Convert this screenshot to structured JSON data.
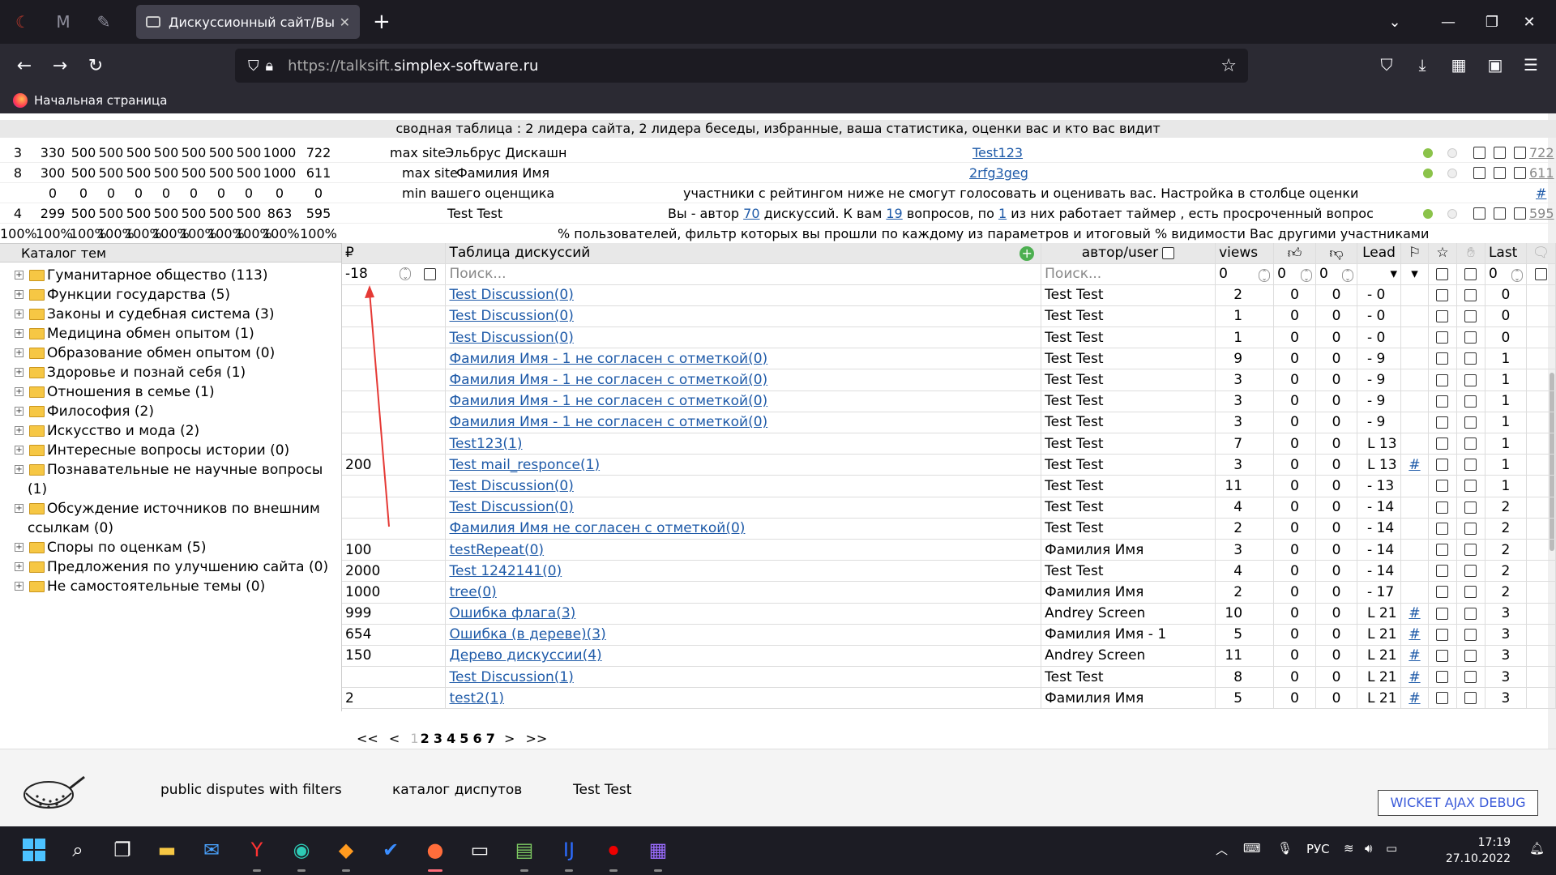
{
  "browser": {
    "tab_title": "Дискуссионный сайт/Выбор т",
    "url_prefix": "https://talksift.",
    "url_domain": "simplex-software.ru",
    "bookmark": "Начальная страница"
  },
  "summary": {
    "title": "сводная таблица : 2 лидера сайта, 2 лидера беседы, избранные, ваша статистика, оценки вас и кто вас видит",
    "rows": [
      {
        "nums": [
          "3",
          "330",
          "500",
          "500",
          "500",
          "500",
          "500",
          "500",
          "500",
          "1000",
          "722"
        ],
        "label": "max site",
        "name": "Эльбрус Дискашн",
        "link": "Test123",
        "end": "722"
      },
      {
        "nums": [
          "8",
          "300",
          "500",
          "500",
          "500",
          "500",
          "500",
          "500",
          "500",
          "1000",
          "611"
        ],
        "label": "max site",
        "name": "Фамилия Имя",
        "link": "2rfg3geg",
        "end": "611"
      },
      {
        "nums": [
          "",
          "0",
          "0",
          "0",
          "0",
          "0",
          "0",
          "0",
          "0",
          "0",
          "0"
        ],
        "label": "min вашего оценщика",
        "text": "участники с рейтингом ниже не смогут голосовать и оценивать вас. Настройка в столбце оценки",
        "end": "#"
      },
      {
        "nums": [
          "4",
          "299",
          "500",
          "500",
          "500",
          "500",
          "500",
          "500",
          "500",
          "863",
          "595"
        ],
        "label": "",
        "name": "Test Test",
        "text_a": "Вы - автор ",
        "link_a": "70",
        "text_b": " дискуссий. К вам ",
        "link_b": "19",
        "text_c": " вопросов, по ",
        "link_c": "1",
        "text_d": " из них работает таймер , есть просроченный вопрос",
        "end": "595"
      }
    ],
    "pct_row": [
      "100%",
      "100%",
      "100%",
      "100%",
      "100%",
      "100%",
      "100%",
      "100%",
      "100%",
      "100%",
      "100%"
    ],
    "pct_text": "% пользователей, фильтр которых вы прошли по каждому из параметров и итоговый % видимости Вас другими участниками"
  },
  "catalog": {
    "title": "Каталог тем",
    "items": [
      "Гуманитарное общество (113)",
      "Функции государства (5)",
      "Законы и судебная система (3)",
      "Медицина обмен опытом (1)",
      "Образование обмен опытом (0)",
      "Здоровье и познай себя (1)",
      "Отношения в семье (1)",
      "Философия (2)",
      "Искусство и мода (2)",
      "Интересные вопросы истории (0)",
      "Познавательные не научные вопросы",
      "(1)",
      "Обсуждение источников по внешним",
      "ссылкам (0)",
      "Споры по оценкам (5)",
      "Предложения по улучшению сайта (0)",
      "Не самостоятельные темы (0)"
    ]
  },
  "table": {
    "h_price": "₽",
    "h_title": "Таблица дискуссий",
    "h_author": "автор/user",
    "h_views": "views",
    "h_lead": "Lead",
    "h_last": "Last",
    "filter_price": "-18",
    "search_placeholder": "Поиск...",
    "author_placeholder": "Поиск...",
    "f_views": "0",
    "f_up": "0",
    "f_down": "0",
    "f_last": "0",
    "rows": [
      {
        "price": "",
        "title": "Test Discussion(0)",
        "author": "Test Test",
        "views": "2",
        "up": "0",
        "down": "0",
        "lead": "- 0",
        "flag": "",
        "last": "0"
      },
      {
        "price": "",
        "title": "Test Discussion(0)",
        "author": "Test Test",
        "views": "1",
        "up": "0",
        "down": "0",
        "lead": "- 0",
        "flag": "",
        "last": "0"
      },
      {
        "price": "",
        "title": "Test Discussion(0)",
        "author": "Test Test",
        "views": "1",
        "up": "0",
        "down": "0",
        "lead": "- 0",
        "flag": "",
        "last": "0"
      },
      {
        "price": "",
        "title": "Фамилия Имя - 1 не согласен с отметкой(0)",
        "author": "Test Test",
        "views": "9",
        "up": "0",
        "down": "0",
        "lead": "- 9",
        "flag": "",
        "last": "1"
      },
      {
        "price": "",
        "title": "Фамилия Имя - 1 не согласен с отметкой(0)",
        "author": "Test Test",
        "views": "3",
        "up": "0",
        "down": "0",
        "lead": "- 9",
        "flag": "",
        "last": "1"
      },
      {
        "price": "",
        "title": "Фамилия Имя - 1 не согласен с отметкой(0)",
        "author": "Test Test",
        "views": "3",
        "up": "0",
        "down": "0",
        "lead": "- 9",
        "flag": "",
        "last": "1"
      },
      {
        "price": "",
        "title": "Фамилия Имя - 1 не согласен с отметкой(0)",
        "author": "Test Test",
        "views": "3",
        "up": "0",
        "down": "0",
        "lead": "- 9",
        "flag": "",
        "last": "1"
      },
      {
        "price": "",
        "title": "Test123(1)",
        "author": "Test Test",
        "views": "7",
        "up": "0",
        "down": "0",
        "lead": "L 13",
        "flag": "",
        "last": "1"
      },
      {
        "price": "200",
        "title": "Test mail_responce(1)",
        "author": "Test Test",
        "views": "3",
        "up": "0",
        "down": "0",
        "lead": "L 13",
        "flag": "#",
        "last": "1"
      },
      {
        "price": "",
        "title": "Test Discussion(0)",
        "author": "Test Test",
        "views": "11",
        "up": "0",
        "down": "0",
        "lead": "- 13",
        "flag": "",
        "last": "1"
      },
      {
        "price": "",
        "title": "Test Discussion(0)",
        "author": "Test Test",
        "views": "4",
        "up": "0",
        "down": "0",
        "lead": "- 14",
        "flag": "",
        "last": "2"
      },
      {
        "price": "",
        "title": "Фамилия Имя не согласен с отметкой(0)",
        "author": "Test Test",
        "views": "2",
        "up": "0",
        "down": "0",
        "lead": "- 14",
        "flag": "",
        "last": "2"
      },
      {
        "price": "100",
        "title": "testRepeat(0)",
        "author": "Фамилия Имя",
        "views": "3",
        "up": "0",
        "down": "0",
        "lead": "- 14",
        "flag": "",
        "last": "2"
      },
      {
        "price": "2000",
        "title": "Test 1242141(0)",
        "author": "Test Test",
        "views": "4",
        "up": "0",
        "down": "0",
        "lead": "- 14",
        "flag": "",
        "last": "2"
      },
      {
        "price": "1000",
        "title": "tree(0)",
        "author": "Фамилия Имя",
        "views": "2",
        "up": "0",
        "down": "0",
        "lead": "- 17",
        "flag": "",
        "last": "2"
      },
      {
        "price": "999",
        "title": "Ошибка флага(3)",
        "author": "Andrey Screen",
        "views": "10",
        "up": "0",
        "down": "0",
        "lead": "L 21",
        "flag": "#",
        "last": "3"
      },
      {
        "price": "654",
        "title": "Ошибка (в дереве)(3)",
        "author": "Фамилия Имя - 1",
        "views": "5",
        "up": "0",
        "down": "0",
        "lead": "L 21",
        "flag": "#",
        "last": "3"
      },
      {
        "price": "150",
        "title": "Дерево дискуссии(4)",
        "author": "Andrey Screen",
        "views": "11",
        "up": "0",
        "down": "0",
        "lead": "L 21",
        "flag": "#",
        "last": "3"
      },
      {
        "price": "",
        "title": "Test Discussion(1)",
        "author": "Test Test",
        "views": "8",
        "up": "0",
        "down": "0",
        "lead": "L 21",
        "flag": "#",
        "last": "3"
      },
      {
        "price": "2",
        "title": "test2(1)",
        "author": "Фамилия Имя",
        "views": "5",
        "up": "0",
        "down": "0",
        "lead": "L 21",
        "flag": "#",
        "last": "3"
      }
    ]
  },
  "pager": {
    "first": "<<",
    "prev": "<",
    "pages": [
      "1",
      "2",
      "3",
      "4",
      "5",
      "6",
      "7"
    ],
    "next": ">",
    "last": ">>"
  },
  "footer": {
    "link1": "public disputes with filters",
    "link2": "каталог диспутов",
    "user": "Test Test",
    "debug": "WICKET AJAX DEBUG"
  },
  "taskbar": {
    "lang": "РУС",
    "time": "17:19",
    "date": "27.10.2022"
  },
  "colors": {
    "link": "#1e5aa8",
    "accent_green": "#4caf50",
    "tab_bg": "#42414d"
  }
}
